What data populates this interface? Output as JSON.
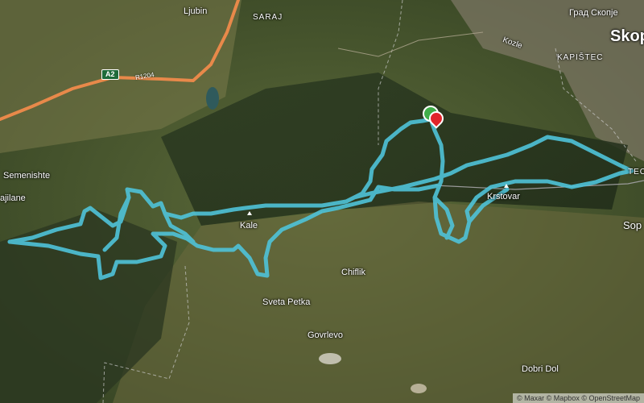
{
  "labels": {
    "ljubin": "Ljubin",
    "saraj": "SARAJ",
    "skopje_cyr": "Град Скопје",
    "skopje": "Skop",
    "kozle": "Kozle",
    "kapistec": "KAPIŠTEC",
    "semenishte": "Semenishte",
    "jilane": "ajilane",
    "kale": "Kale",
    "krstovar": "Krstovar",
    "chiflik": "Chiflik",
    "sveta_petka": "Sveta Petka",
    "govrlevo": "Govrlevo",
    "dobri_dol": "Dobri Dol",
    "tec": "TEC",
    "sop": "Sop"
  },
  "roads": {
    "a2_shield": "A2",
    "r1204": "R1204"
  },
  "attribution": "© Maxar © Mapbox © OpenStreetMap",
  "colors": {
    "route": "#4fc3d9",
    "highway": "#e8894a",
    "start_marker": "#3fae49",
    "end_marker": "#e0242b"
  }
}
